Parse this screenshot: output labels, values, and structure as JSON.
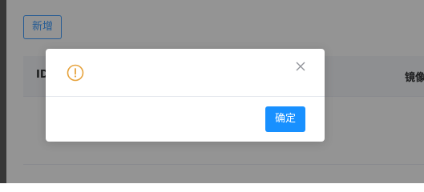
{
  "toolbar": {
    "add_label": "新增"
  },
  "table": {
    "headers": {
      "id": "ID",
      "image": "镜像"
    }
  },
  "dialog": {
    "icon": "warning-circle-icon",
    "close_icon": "close-icon",
    "confirm_label": "确定"
  },
  "colors": {
    "primary": "#409eff",
    "confirm_bg": "#1890ff",
    "warning": "#e6a23c",
    "overlay": "rgba(0,0,0,0.42)"
  }
}
